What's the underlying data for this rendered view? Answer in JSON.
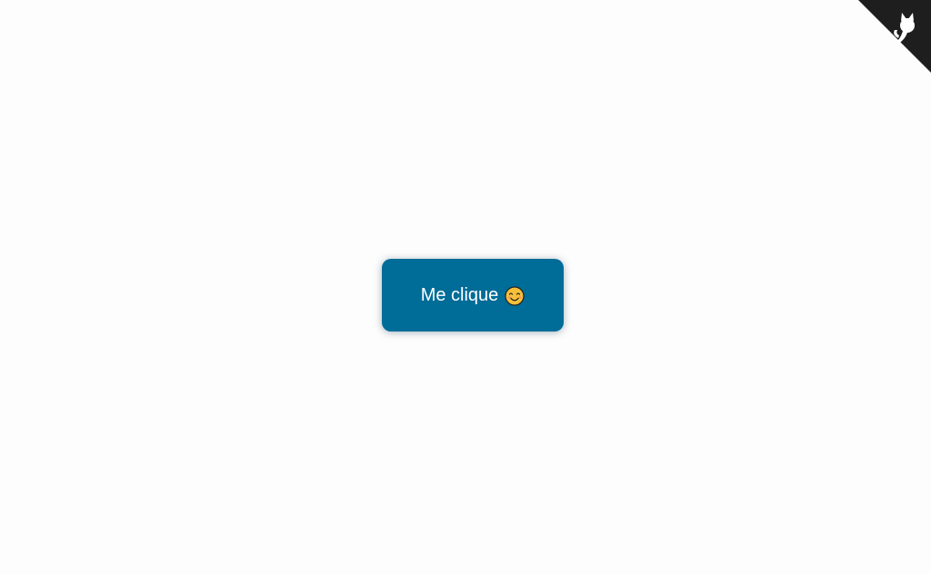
{
  "button": {
    "label": "Me clique",
    "emoji_icon": "smiling-face-icon",
    "background": "#006c98",
    "text_color": "#ffffff"
  },
  "corner_link": {
    "icon": "github-octocat-icon",
    "background": "#1e1e1e"
  }
}
